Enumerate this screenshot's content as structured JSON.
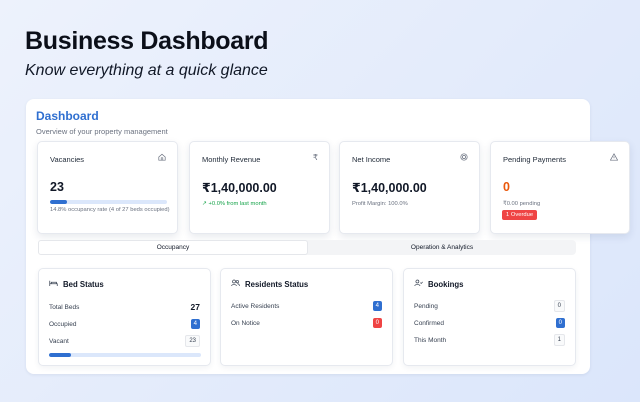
{
  "hero": {
    "title": "Business Dashboard",
    "subtitle": "Know everything at a quick glance"
  },
  "panel": {
    "title": "Dashboard",
    "subtitle": "Overview of your property management"
  },
  "stats": {
    "vacancies": {
      "label": "Vacancies",
      "icon": "home-icon",
      "value": "23",
      "occupancy_fraction": 0.148,
      "note": "14.8% occupancy rate (4 of 27 beds occupied)"
    },
    "revenue": {
      "label": "Monthly Revenue",
      "icon": "rupee-icon",
      "value": "₹1,40,000.00",
      "note": "↗ +0.0% from last month"
    },
    "income": {
      "label": "Net Income",
      "icon": "target-icon",
      "value": "₹1,40,000.00",
      "note": "Profit Margin: 100.0%"
    },
    "payments": {
      "label": "Pending Payments",
      "icon": "warning-icon",
      "value": "0",
      "note": "₹0.00 pending",
      "badge": "1 Overdue"
    }
  },
  "tabs": [
    {
      "label": "Occupancy",
      "active": true
    },
    {
      "label": "Operation & Analytics",
      "active": false
    }
  ],
  "bed_status": {
    "title": "Bed Status",
    "icon": "bed-icon",
    "rows": [
      {
        "label": "Total Beds",
        "value": "27"
      },
      {
        "label": "Occupied",
        "value": "4"
      },
      {
        "label": "Vacant",
        "value": "23"
      }
    ],
    "occupied_fraction": 0.148
  },
  "residents": {
    "title": "Residents Status",
    "icon": "users-icon",
    "rows": [
      {
        "label": "Active Residents",
        "value": "4"
      },
      {
        "label": "On Notice",
        "value": "0"
      }
    ]
  },
  "bookings": {
    "title": "Bookings",
    "icon": "user-check-icon",
    "rows": [
      {
        "label": "Pending",
        "value": "0"
      },
      {
        "label": "Confirmed",
        "value": "0"
      },
      {
        "label": "This Month",
        "value": "1"
      }
    ]
  },
  "colors": {
    "accent": "#2f6fd0",
    "danger": "#ef4444",
    "warning": "#ea580c",
    "success": "#16a34a"
  }
}
